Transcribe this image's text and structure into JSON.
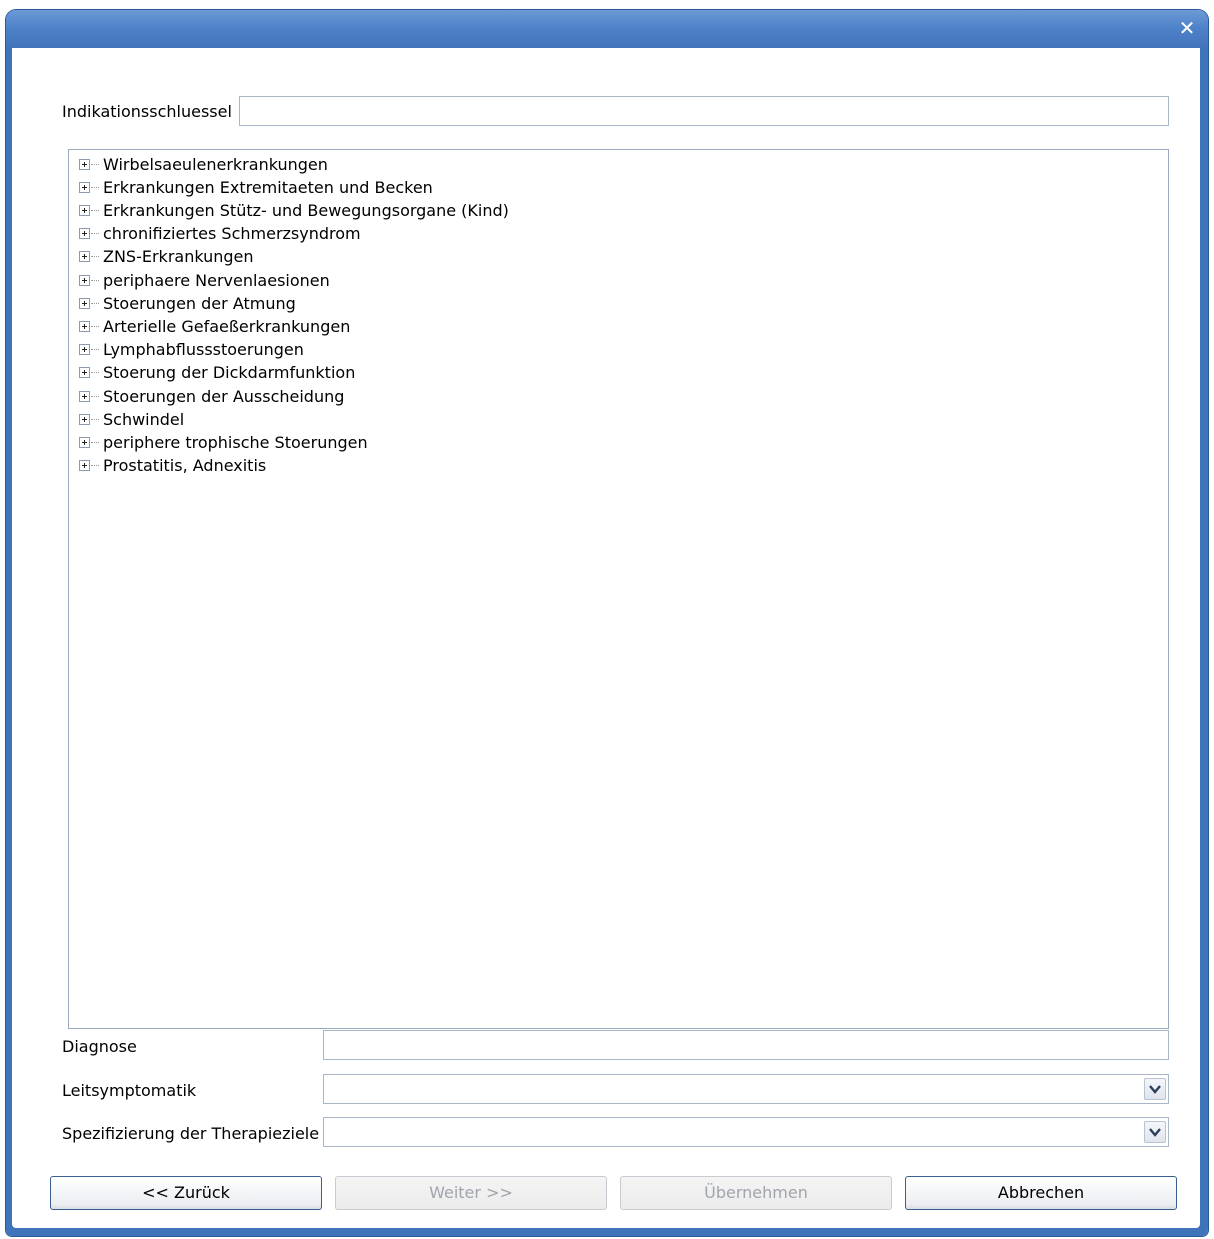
{
  "window": {
    "close_label": "✕"
  },
  "indikation": {
    "label": "Indikationsschluessel",
    "value": ""
  },
  "tree": {
    "items": [
      "Wirbelsaeulenerkrankungen",
      "Erkrankungen Extremitaeten und Becken",
      "Erkrankungen Stütz- und Bewegungsorgane (Kind)",
      "chronifiziertes Schmerzsyndrom",
      "ZNS-Erkrankungen",
      "periphaere Nervenlaesionen",
      "Stoerungen der Atmung",
      "Arterielle Gefaeßerkrankungen",
      "Lymphabflussstoerungen",
      "Stoerung der Dickdarmfunktion",
      "Stoerungen der Ausscheidung",
      "Schwindel",
      "periphere trophische Stoerungen",
      "Prostatitis,  Adnexitis"
    ]
  },
  "diagnose": {
    "label": "Diagnose",
    "value": ""
  },
  "leitsymptomatik": {
    "label": "Leitsymptomatik",
    "value": ""
  },
  "therapieziele": {
    "label": "Spezifizierung der Therapieziele",
    "value": ""
  },
  "buttons": {
    "back": "<< Zurück",
    "next": "Weiter >>",
    "apply": "Übernehmen",
    "cancel": "Abbrechen"
  }
}
